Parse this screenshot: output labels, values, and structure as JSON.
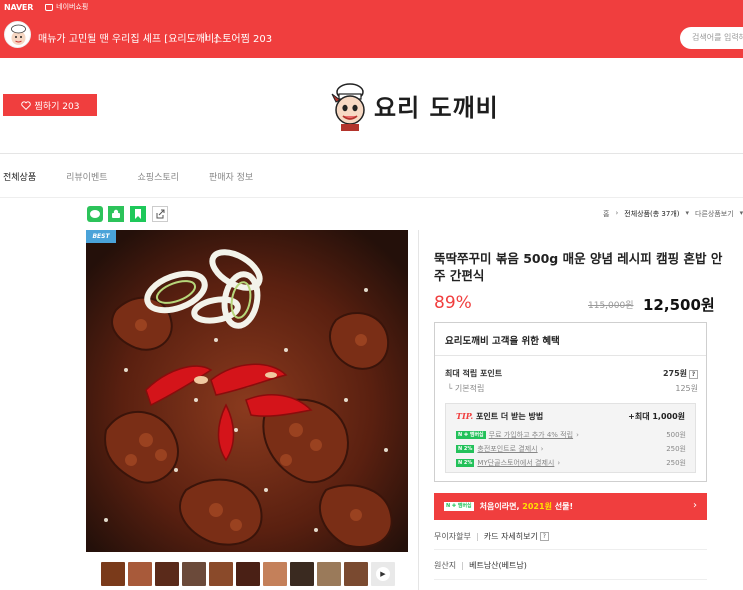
{
  "topbar": {
    "naver": "NAVER",
    "shopping": "네이버쇼핑"
  },
  "store": {
    "name": "매뉴가 고민될 땐 우리집 셰프 [요리도깨비]",
    "zzim": "스토어찜 203",
    "search_placeholder": "검색어를 입력해"
  },
  "like_button": "찜하기 203",
  "logo_text": "요리 도깨비",
  "nav": [
    "전체상품",
    "리뷰이벤트",
    "쇼핑스토리",
    "판매자 정보"
  ],
  "breadcrumb": {
    "home": "홈",
    "all": "전체상품(총 37개)",
    "more": "다른상품보기"
  },
  "badge": "BEST",
  "product": {
    "title": "뚝딱쭈꾸미 볶음 500g 매운 양념 레시피 캠핑 혼밥 안주 간편식",
    "discount": "89%",
    "original_price": "115,000원",
    "price": "12,500원"
  },
  "benefit": {
    "heading": "요리도깨비 고객을 위한 혜택",
    "max_point_label": "최대 적립 포인트",
    "max_point_value": "275원",
    "base_label": "기본적립",
    "base_value": "125원",
    "tip_prefix": "TIP.",
    "tip_title": "포인트 더 받는 방법",
    "tip_max": "+최대 1,000원",
    "tips": [
      {
        "badge": "N ✚ 멤버십",
        "label": "무료 가입하고 추가 4% 적립",
        "value": "500원"
      },
      {
        "badge": "N 2%",
        "label": "충전포인트로 결제시",
        "value": "250원"
      },
      {
        "badge": "N 2%",
        "label": "MY단골스토어에서 결제시",
        "value": "250원"
      }
    ]
  },
  "promo": {
    "badge": "N ✚ 멤버십",
    "text_before": "처음이라면,",
    "text_highlight": "2021원",
    "text_after": "선물!"
  },
  "info": {
    "installment": "무이자할부",
    "card_detail": "카드 자세히보기",
    "origin_label": "원산지",
    "origin_value": "베트남산(베트남)"
  },
  "colors": {
    "brand_red": "#f03e3e",
    "npay_green": "#23c15a"
  }
}
